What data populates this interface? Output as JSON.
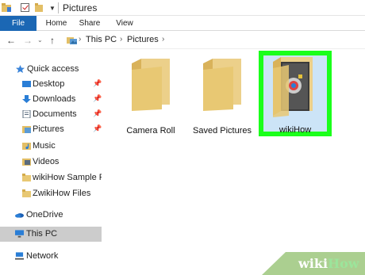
{
  "window": {
    "title": "Pictures"
  },
  "ribbon": {
    "tabs": [
      {
        "label": "File"
      },
      {
        "label": "Home"
      },
      {
        "label": "Share"
      },
      {
        "label": "View"
      }
    ]
  },
  "address": {
    "breadcrumbs": [
      "This PC",
      "Pictures"
    ]
  },
  "sidebar": {
    "items": [
      {
        "label": "Quick access",
        "icon": "star-icon",
        "pinned": false
      },
      {
        "label": "Desktop",
        "icon": "desktop-icon",
        "pinned": true
      },
      {
        "label": "Downloads",
        "icon": "downloads-icon",
        "pinned": true
      },
      {
        "label": "Documents",
        "icon": "documents-icon",
        "pinned": true
      },
      {
        "label": "Pictures",
        "icon": "pictures-icon",
        "pinned": true
      },
      {
        "label": "Music",
        "icon": "music-icon",
        "pinned": false
      },
      {
        "label": "Videos",
        "icon": "videos-icon",
        "pinned": false
      },
      {
        "label": "wikiHow Sample Files",
        "icon": "folder-icon",
        "pinned": false
      },
      {
        "label": "ZwikiHow Files",
        "icon": "folder-icon",
        "pinned": false
      },
      {
        "label": "OneDrive",
        "icon": "onedrive-icon",
        "pinned": false
      },
      {
        "label": "This PC",
        "icon": "this-pc-icon",
        "pinned": false,
        "selected": true
      },
      {
        "label": "Network",
        "icon": "network-icon",
        "pinned": false
      }
    ]
  },
  "content": {
    "folders": [
      {
        "name": "Camera Roll"
      },
      {
        "name": "Saved Pictures"
      },
      {
        "name": "wikiHow",
        "selected": true
      }
    ]
  },
  "watermark": {
    "text_wiki": "wiki",
    "text_how": "How"
  },
  "colors": {
    "file_tab": "#1b67b4",
    "folder_yellow": "#e8c873",
    "highlight_green": "#1bff1b",
    "selected_row": "#cccccc"
  }
}
